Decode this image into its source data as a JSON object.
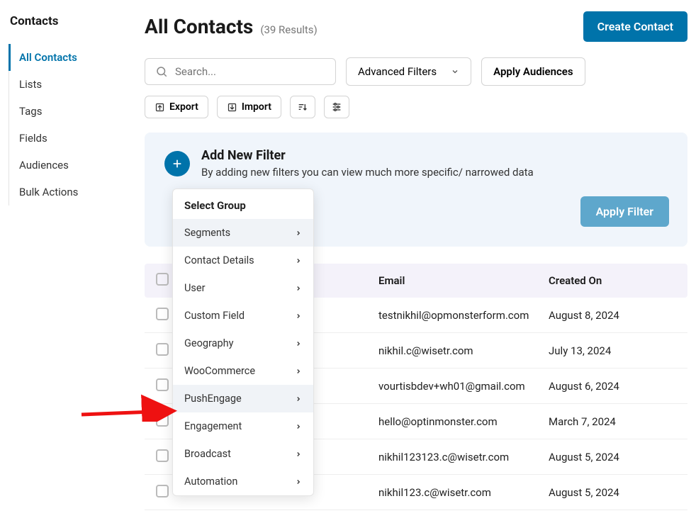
{
  "sidebar": {
    "title": "Contacts",
    "items": [
      {
        "label": "All Contacts",
        "active": true
      },
      {
        "label": "Lists"
      },
      {
        "label": "Tags"
      },
      {
        "label": "Fields"
      },
      {
        "label": "Audiences"
      },
      {
        "label": "Bulk Actions"
      }
    ]
  },
  "header": {
    "title": "All Contacts",
    "results": "(39 Results)",
    "create_button": "Create Contact"
  },
  "toolbar": {
    "search_placeholder": "Search...",
    "advanced_filters": "Advanced Filters",
    "apply_audiences": "Apply Audiences",
    "export": "Export",
    "import": "Import"
  },
  "filter_panel": {
    "title": "Add New Filter",
    "desc": "By adding new filters you can view much more specific/ narrowed data",
    "apply": "Apply Filter"
  },
  "dropdown": {
    "header": "Select Group",
    "items": [
      {
        "label": "Segments",
        "hover": true
      },
      {
        "label": "Contact Details"
      },
      {
        "label": "User"
      },
      {
        "label": "Custom Field"
      },
      {
        "label": "Geography"
      },
      {
        "label": "WooCommerce"
      },
      {
        "label": "PushEngage",
        "hover": true
      },
      {
        "label": "Engagement"
      },
      {
        "label": "Broadcast"
      },
      {
        "label": "Automation"
      }
    ]
  },
  "table": {
    "columns": {
      "email": "Email",
      "created": "Created On"
    },
    "rows": [
      {
        "email": "testnikhil@opmonsterform.com",
        "created": "August 8, 2024"
      },
      {
        "email": "nikhil.c@wisetr.com",
        "created": "July 13, 2024"
      },
      {
        "email": "vourtisbdev+wh01@gmail.com",
        "created": "August 6, 2024"
      },
      {
        "email": "hello@optinmonster.com",
        "created": "March 7, 2024"
      },
      {
        "email": "nikhil123123.c@wisetr.com",
        "created": "August 5, 2024"
      },
      {
        "email": "nikhil123.c@wisetr.com",
        "created": "August 5, 2024"
      }
    ]
  }
}
